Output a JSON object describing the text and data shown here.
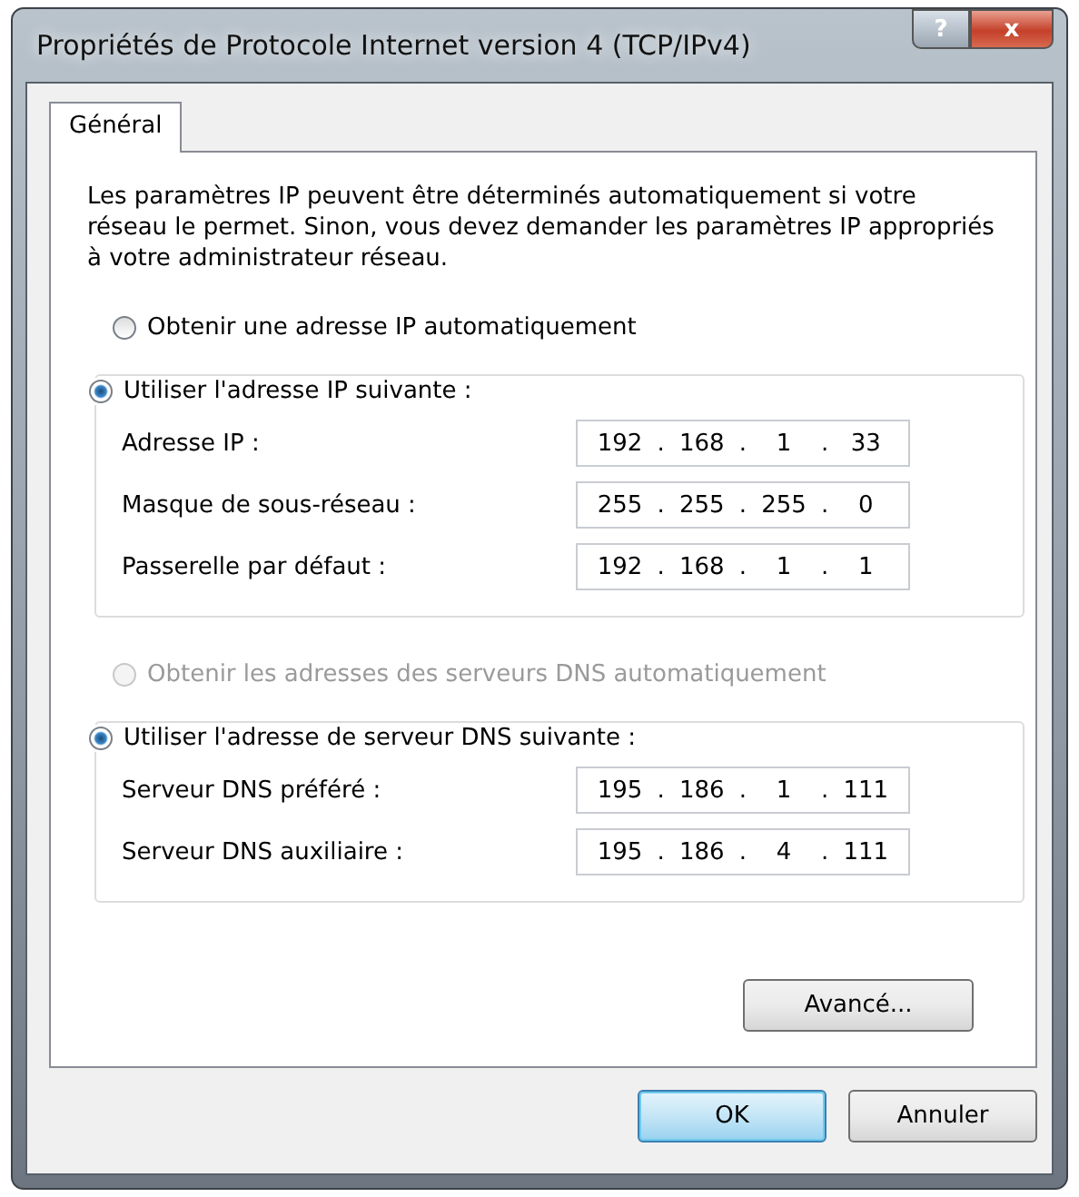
{
  "window": {
    "title": "Propriétés de Protocole Internet version 4 (TCP/IPv4)",
    "help_button": "?",
    "close_button": "x"
  },
  "tabs": [
    {
      "label": "Général",
      "selected": true
    }
  ],
  "description": "Les paramètres IP peuvent être déterminés automatiquement si votre réseau le permet. Sinon, vous devez demander les paramètres IP appropriés à votre administrateur réseau.",
  "octet_separator": ".",
  "ip_section": {
    "auto_option": {
      "label": "Obtenir une adresse IP automatiquement",
      "selected": false,
      "disabled": false
    },
    "manual_option": {
      "label": "Utiliser l'adresse IP suivante :",
      "selected": true,
      "disabled": false
    },
    "fields": [
      {
        "label": "Adresse IP :",
        "octets": [
          "192",
          "168",
          "1",
          "33"
        ]
      },
      {
        "label": "Masque de sous-réseau :",
        "octets": [
          "255",
          "255",
          "255",
          "0"
        ]
      },
      {
        "label": "Passerelle par défaut :",
        "octets": [
          "192",
          "168",
          "1",
          "1"
        ]
      }
    ]
  },
  "dns_section": {
    "auto_option": {
      "label": "Obtenir les adresses des serveurs DNS automatiquement",
      "selected": false,
      "disabled": true
    },
    "manual_option": {
      "label": "Utiliser l'adresse de serveur DNS suivante :",
      "selected": true,
      "disabled": false
    },
    "fields": [
      {
        "label": "Serveur DNS préféré :",
        "octets": [
          "195",
          "186",
          "1",
          "111"
        ]
      },
      {
        "label": "Serveur DNS auxiliaire :",
        "octets": [
          "195",
          "186",
          "4",
          "111"
        ]
      }
    ]
  },
  "advanced_button": "Avancé...",
  "buttons": [
    {
      "label": "OK",
      "default": true
    },
    {
      "label": "Annuler",
      "default": false
    }
  ]
}
